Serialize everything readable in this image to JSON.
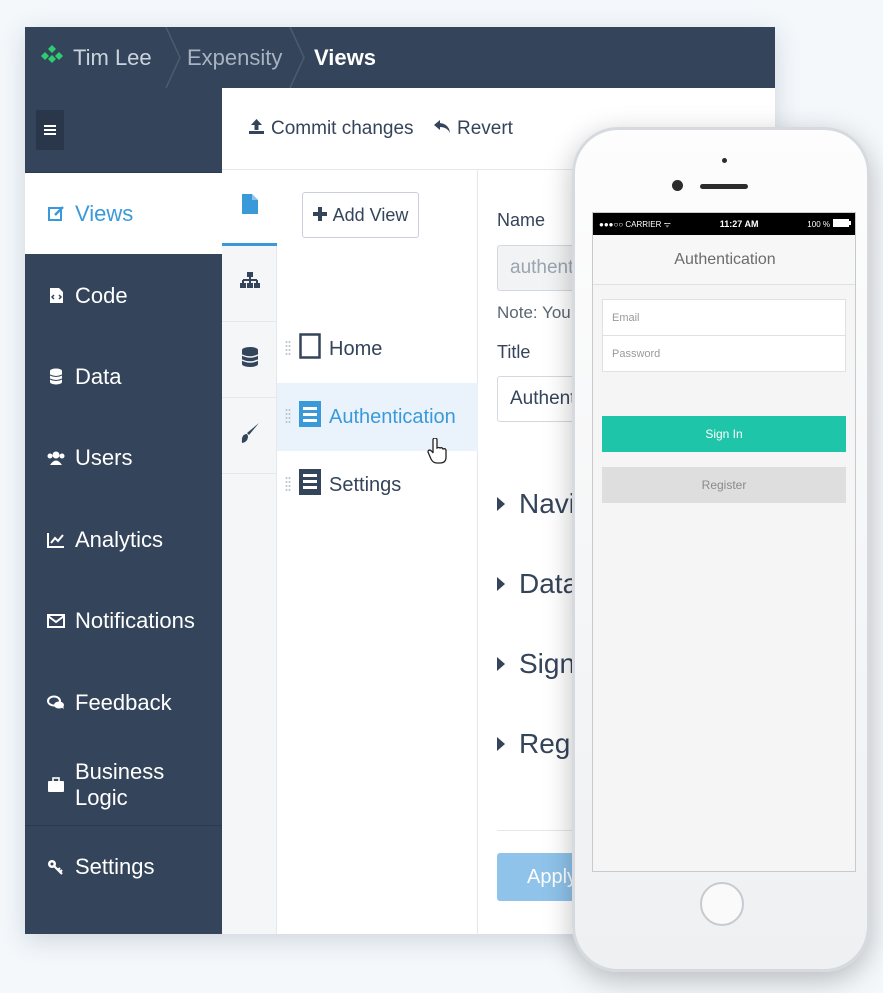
{
  "topbar": {
    "user": "Tim Lee",
    "project": "Expensity",
    "current": "Views",
    "brand_color": "#2ecc71"
  },
  "sidebar": {
    "menu_icon": "hamburger-icon",
    "items": [
      {
        "label": "Views",
        "icon": "edit-icon",
        "active": true
      },
      {
        "label": "Code",
        "icon": "code-file-icon"
      },
      {
        "label": "Data",
        "icon": "database-icon"
      },
      {
        "label": "Users",
        "icon": "users-icon"
      },
      {
        "label": "Analytics",
        "icon": "line-chart-icon"
      },
      {
        "label": "Notifications",
        "icon": "envelope-icon"
      },
      {
        "label": "Feedback",
        "icon": "chat-icon"
      },
      {
        "label": "Business Logic",
        "icon": "briefcase-icon"
      },
      {
        "label": "Settings",
        "icon": "key-icon"
      }
    ]
  },
  "toolbar": {
    "commit_label": "Commit changes",
    "revert_label": "Revert"
  },
  "vtabs": [
    "file-icon",
    "sitemap-icon",
    "database-icon",
    "brush-icon"
  ],
  "views": {
    "add_label": "Add View",
    "items": [
      {
        "label": "Home"
      },
      {
        "label": "Authentication",
        "active": true
      },
      {
        "label": "Settings"
      }
    ]
  },
  "props": {
    "name_label": "Name",
    "name_value": "authent",
    "note": "Note: You c",
    "title_label": "Title",
    "title_value": "Authent",
    "sections": [
      "Navi",
      "Data",
      "Sign",
      "Regi"
    ],
    "apply_label": "Apply"
  },
  "phone": {
    "carrier": "●●●○○ CARRIER ᯤ",
    "time": "11:27 AM",
    "battery": "100 %",
    "screen_title": "Authentication",
    "email_placeholder": "Email",
    "password_placeholder": "Password",
    "signin_label": "Sign In",
    "register_label": "Register",
    "accent": "#1fc5a8"
  }
}
